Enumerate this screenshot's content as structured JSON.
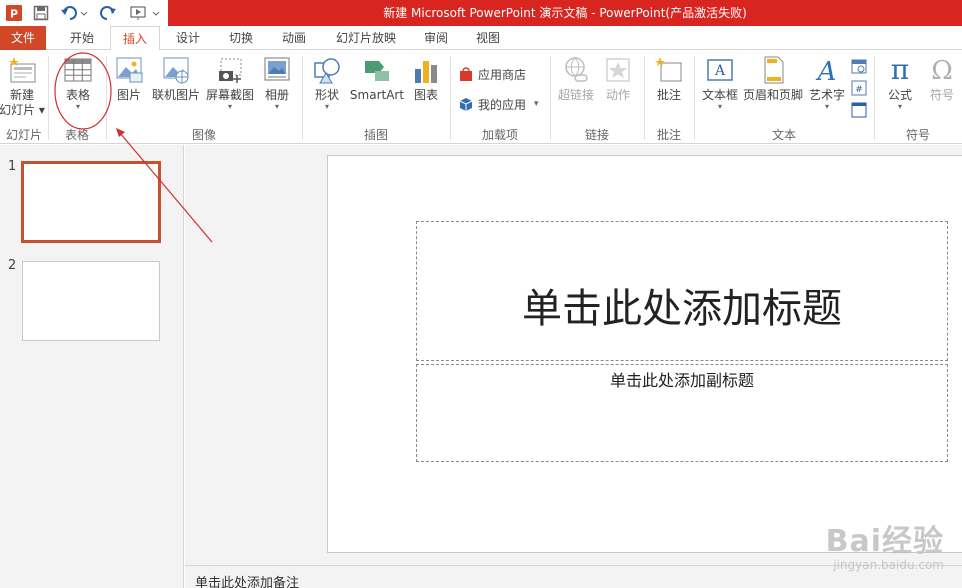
{
  "window": {
    "title": "新建 Microsoft PowerPoint 演示文稿 -  PowerPoint(产品激活失败)"
  },
  "colors": {
    "accent": "#d24726",
    "titlebar": "#d9251f",
    "annotation": "#d32f2f"
  },
  "quick_access": [
    "powerpoint-logo-icon",
    "save-icon",
    "undo-icon",
    "redo-icon",
    "start-slideshow-icon"
  ],
  "tabs": {
    "file": "文件",
    "home": "开始",
    "insert": "插入",
    "design": "设计",
    "transitions": "切换",
    "animations": "动画",
    "slideshow": "幻灯片放映",
    "review": "审阅",
    "view": "视图"
  },
  "ribbon": {
    "new_slide_1": "新建",
    "new_slide_2": "幻灯片",
    "table": "表格",
    "picture": "图片",
    "online_picture": "联机图片",
    "screenshot": "屏幕截图",
    "album": "相册",
    "shapes": "形状",
    "smartart": "SmartArt",
    "chart": "图表",
    "store": "应用商店",
    "my_apps": "我的应用",
    "hyperlink": "超链接",
    "action": "动作",
    "comment": "批注",
    "textbox": "文本框",
    "header_footer": "页眉和页脚",
    "wordart": "艺术字",
    "equation": "公式",
    "symbol": "符号",
    "groups": {
      "slides": "幻灯片",
      "tables": "表格",
      "images": "图像",
      "illustrations": "插图",
      "addins": "加载项",
      "links": "链接",
      "comments": "批注",
      "text": "文本",
      "symbols": "符号"
    }
  },
  "thumbnails": [
    {
      "number": "1",
      "selected": true
    },
    {
      "number": "2",
      "selected": false
    }
  ],
  "slide": {
    "title_placeholder": "单击此处添加标题",
    "subtitle_placeholder": "单击此处添加副标题"
  },
  "notes_placeholder": "单击此处添加备注",
  "watermark": {
    "brand": "Bai经验",
    "url": "jingyan.baidu.com"
  }
}
